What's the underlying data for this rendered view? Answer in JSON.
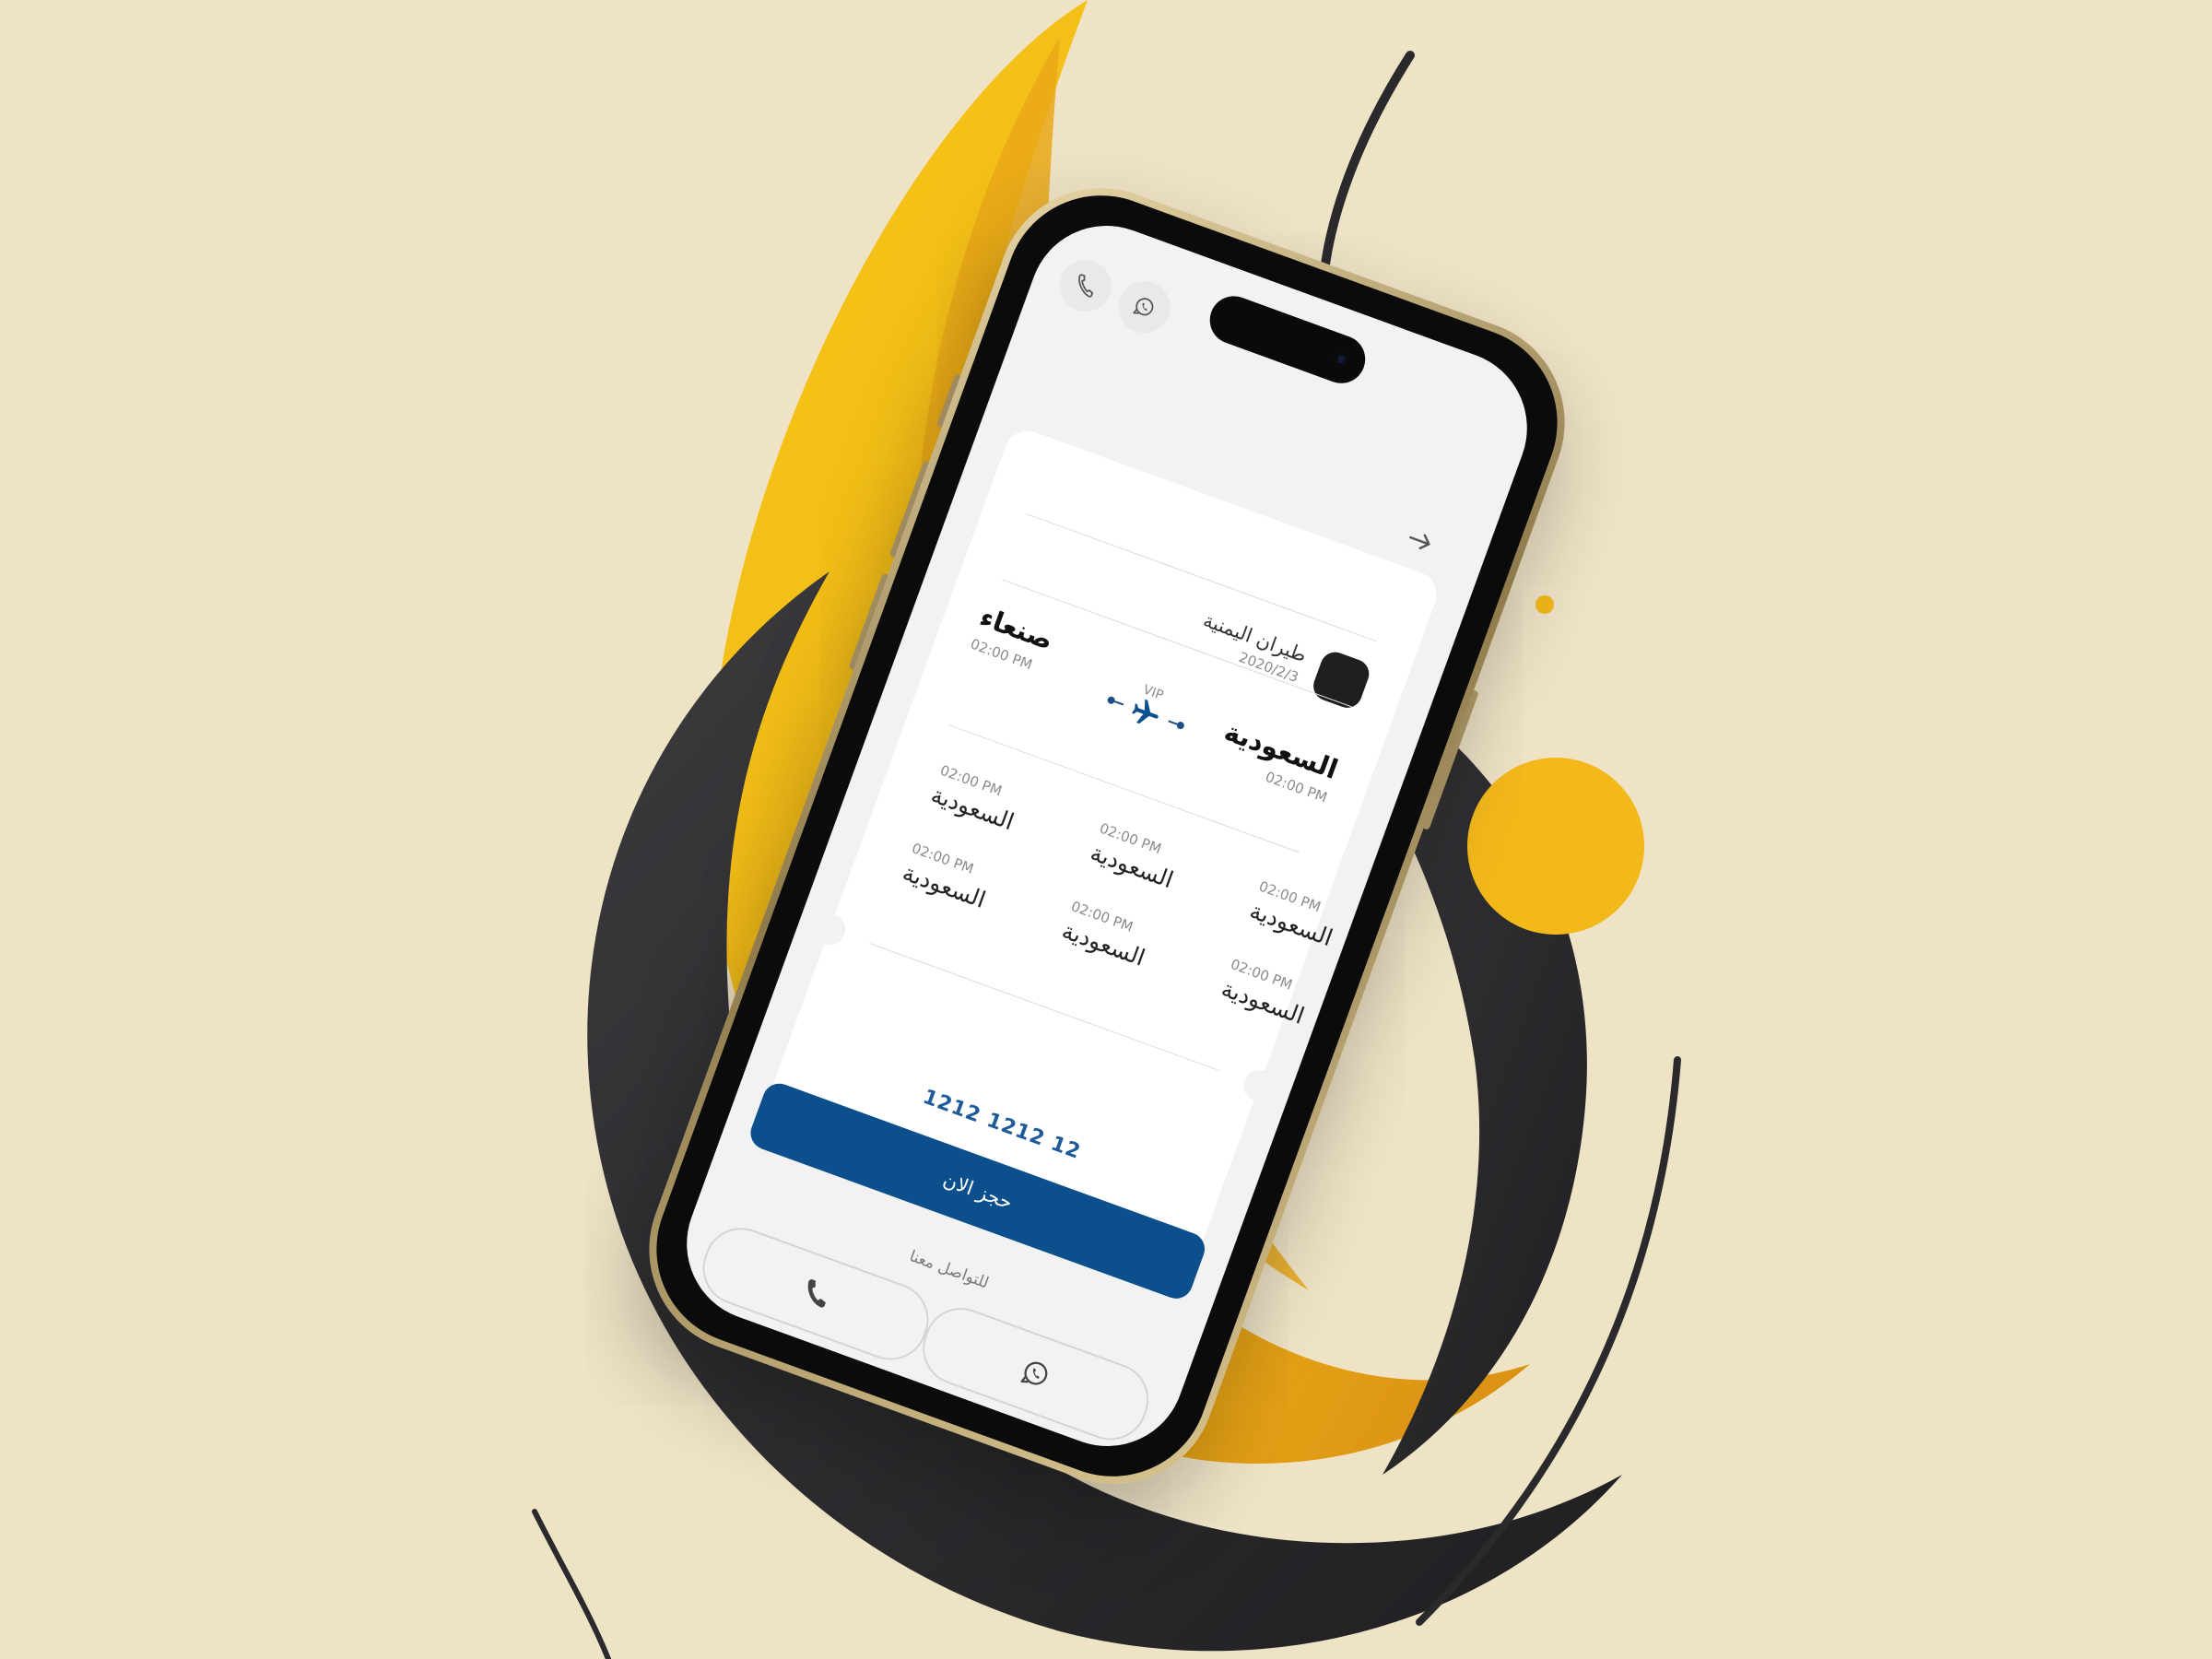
{
  "screen": {
    "header": {
      "back_icon": "arrow-icon",
      "quick_actions": [
        {
          "icon": "phone-icon"
        },
        {
          "icon": "whatsapp-icon"
        }
      ]
    },
    "ticket": {
      "airline_name": "طيران اليمنية",
      "date": "2020/2/3",
      "route": {
        "from_city": "السعودية",
        "from_time": "02:00 PM",
        "to_city": "صنعاء",
        "to_time": "02:00 PM",
        "class_label": "VIP"
      },
      "stops": [
        {
          "time": "02:00 PM",
          "city": "السعودية"
        },
        {
          "time": "02:00 PM",
          "city": "السعودية"
        },
        {
          "time": "02:00 PM",
          "city": "السعودية"
        },
        {
          "time": "02:00 PM",
          "city": "السعودية"
        },
        {
          "time": "02:00 PM",
          "city": "السعودية"
        },
        {
          "time": "02:00 PM",
          "city": "السعودية"
        }
      ],
      "ticket_number": "1212 1212 12"
    },
    "book_button_label": "حجز الان",
    "contact": {
      "label": "للتواصل معنا",
      "whatsapp_icon": "whatsapp-icon",
      "phone_icon": "phone-icon"
    }
  },
  "colors": {
    "background": "#efe3c6",
    "accent_yellow": "#f3b81a",
    "dark_swoosh": "#2b2b2e",
    "primary_blue": "#0b4f8c",
    "screen_bg": "#f2f2f2"
  }
}
